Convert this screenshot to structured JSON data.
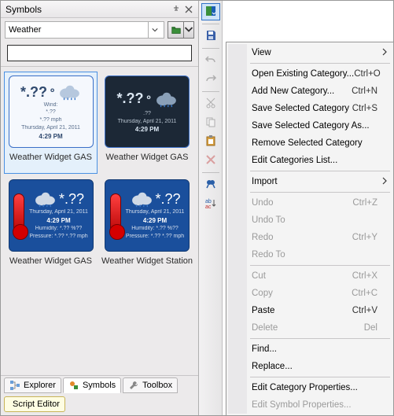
{
  "panel": {
    "title": "Symbols",
    "category_selected": "Weather",
    "search_value": "",
    "search_placeholder": ""
  },
  "gallery": {
    "items": [
      {
        "caption": "Weather Widget GAS",
        "variant": "light",
        "temp": "*.??",
        "unit": "º",
        "wind": "Wind:\n*.??",
        "mph": "*.?? mph",
        "date": "Thursday, April 21, 2011",
        "time": "4:29 PM"
      },
      {
        "caption": "Weather Widget GAS",
        "variant": "dark",
        "temp": "*.??",
        "unit": "º",
        "wind": "",
        "mph": ".??",
        "date": "Thursday, April 21, 2011",
        "time": "4:29 PM"
      },
      {
        "caption": "Weather Widget GAS",
        "variant": "blue",
        "temp": "*.??",
        "unit": "",
        "wind": "",
        "mph": "Humidity: *.??   %??",
        "date": "Thursday, April 21, 2011",
        "time": "4:29 PM",
        "extra": "Pressure: *.??   *.?? mph"
      },
      {
        "caption": "Weather Widget Station",
        "variant": "blue",
        "temp": "*.??",
        "unit": "",
        "wind": "",
        "mph": "Humidity: *.??   %??",
        "date": "Thursday, April 21, 2011",
        "time": "4:29 PM",
        "extra": "Pressure: *.??   *.?? mph"
      }
    ]
  },
  "tabs": {
    "row1": [
      {
        "label": "Explorer",
        "active": false,
        "icon": "tree"
      },
      {
        "label": "Symbols",
        "active": true,
        "icon": "shapes"
      },
      {
        "label": "Toolbox",
        "active": false,
        "icon": "wrench"
      }
    ],
    "row2": [
      {
        "label": "Script Editor",
        "icon": "script"
      }
    ]
  },
  "vtoolbar": [
    {
      "name": "action-dropdown",
      "icon": "dropdown",
      "state": "sel"
    },
    {
      "sep": true
    },
    {
      "name": "save",
      "icon": "save",
      "state": ""
    },
    {
      "sep": true
    },
    {
      "name": "undo",
      "icon": "undo",
      "state": "disabled"
    },
    {
      "name": "redo",
      "icon": "redo",
      "state": "disabled"
    },
    {
      "sep": true
    },
    {
      "name": "cut",
      "icon": "cut",
      "state": "disabled"
    },
    {
      "name": "copy",
      "icon": "copy",
      "state": "disabled"
    },
    {
      "name": "paste",
      "icon": "paste",
      "state": ""
    },
    {
      "name": "delete",
      "icon": "delete",
      "state": "disabled"
    },
    {
      "sep": true
    },
    {
      "name": "find",
      "icon": "find",
      "state": ""
    },
    {
      "name": "replace",
      "icon": "replace",
      "state": ""
    }
  ],
  "menu": [
    {
      "label": "View",
      "submenu": true
    },
    {
      "sep": true
    },
    {
      "label": "Open Existing Category...",
      "shortcut": "Ctrl+O"
    },
    {
      "label": "Add New Category...",
      "shortcut": "Ctrl+N"
    },
    {
      "label": "Save Selected Category",
      "shortcut": "Ctrl+S"
    },
    {
      "label": "Save Selected Category As..."
    },
    {
      "label": "Remove Selected Category"
    },
    {
      "label": "Edit Categories List..."
    },
    {
      "sep": true
    },
    {
      "label": "Import",
      "submenu": true
    },
    {
      "sep": true
    },
    {
      "label": "Undo",
      "shortcut": "Ctrl+Z",
      "disabled": true
    },
    {
      "label": "Undo To",
      "disabled": true
    },
    {
      "label": "Redo",
      "shortcut": "Ctrl+Y",
      "disabled": true
    },
    {
      "label": "Redo To",
      "disabled": true
    },
    {
      "sep": true
    },
    {
      "label": "Cut",
      "shortcut": "Ctrl+X",
      "disabled": true
    },
    {
      "label": "Copy",
      "shortcut": "Ctrl+C",
      "disabled": true
    },
    {
      "label": "Paste",
      "shortcut": "Ctrl+V"
    },
    {
      "label": "Delete",
      "shortcut": "Del",
      "disabled": true
    },
    {
      "sep": true
    },
    {
      "label": "Find..."
    },
    {
      "label": "Replace..."
    },
    {
      "sep": true
    },
    {
      "label": "Edit Category Properties..."
    },
    {
      "label": "Edit Symbol Properties...",
      "disabled": true
    }
  ]
}
